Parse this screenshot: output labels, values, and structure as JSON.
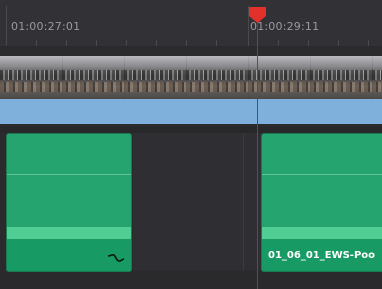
{
  "ruler": {
    "timecode_left": "01:00:27:01",
    "timecode_right": "01:00:29:11"
  },
  "audio": {
    "clip_right_label": "01_06_01_EWS-Poo"
  },
  "colors": {
    "audio_clip": "#25a46f",
    "video_bar": "#7fb0db",
    "playhead": "#e2302b"
  },
  "icons": {
    "fade": "audio-fade-icon",
    "playhead": "playhead-marker-icon"
  }
}
